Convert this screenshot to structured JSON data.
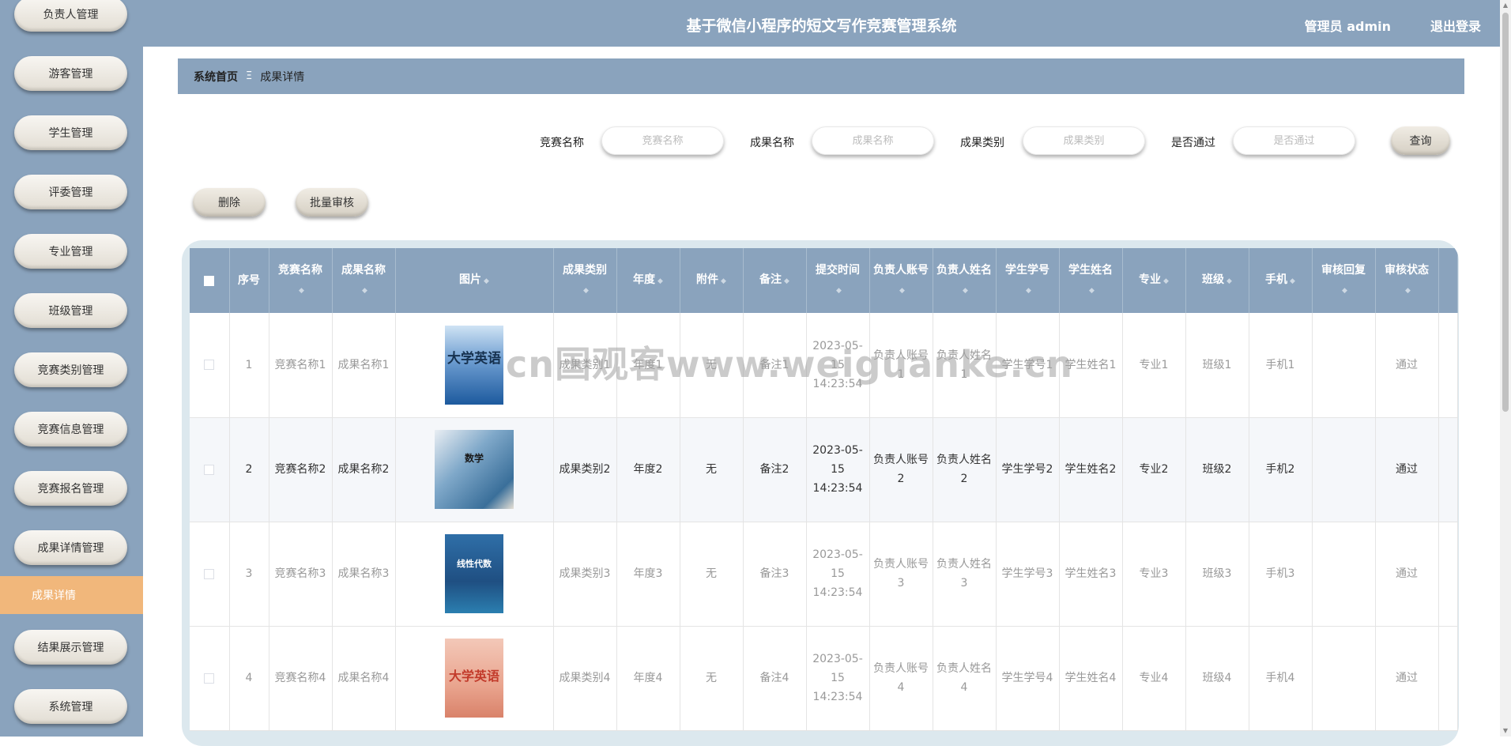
{
  "header": {
    "title": "基于微信小程序的短文写作竞赛管理系统",
    "user": "管理员 admin",
    "logout": "退出登录"
  },
  "sidebar": {
    "items": [
      "负责人管理",
      "游客管理",
      "学生管理",
      "评委管理",
      "专业管理",
      "班级管理",
      "竞赛类别管理",
      "竞赛信息管理",
      "竞赛报名管理",
      "成果详情管理",
      "结果展示管理",
      "系统管理"
    ],
    "active_sub": "成果详情"
  },
  "breadcrumb": {
    "home": "系统首页",
    "separator": "Ξ",
    "current": "成果详情"
  },
  "search": {
    "fields": [
      {
        "label": "竞赛名称",
        "placeholder": "竞赛名称"
      },
      {
        "label": "成果名称",
        "placeholder": "成果名称"
      },
      {
        "label": "成果类别",
        "placeholder": "成果类别"
      },
      {
        "label": "是否通过",
        "placeholder": "是否通过"
      }
    ],
    "query_button": "查询"
  },
  "actions": {
    "delete": "删除",
    "batch_review": "批量审核"
  },
  "table": {
    "columns": [
      "序号",
      "竞赛名称",
      "成果名称",
      "图片",
      "成果类别",
      "年度",
      "附件",
      "备注",
      "提交时间",
      "负责人账号",
      "负责人姓名",
      "学生学号",
      "学生姓名",
      "专业",
      "班级",
      "手机",
      "审核回复",
      "审核状态"
    ],
    "rows": [
      {
        "index": "1",
        "contest": "竞赛名称1",
        "name": "成果名称1",
        "image": "大学英语",
        "category": "成果类别1",
        "year": "年度1",
        "attachment": "无",
        "remark": "备注1",
        "time": "2023-05-15 14:23:54",
        "account": "负责人账号1",
        "manager": "负责人姓名1",
        "student_no": "学生学号1",
        "student": "学生姓名1",
        "major": "专业1",
        "class": "班级1",
        "phone": "手机1",
        "reply": "",
        "status": "通过"
      },
      {
        "index": "2",
        "contest": "竞赛名称2",
        "name": "成果名称2",
        "image": "数学",
        "category": "成果类别2",
        "year": "年度2",
        "attachment": "无",
        "remark": "备注2",
        "time": "2023-05-15 14:23:54",
        "account": "负责人账号2",
        "manager": "负责人姓名2",
        "student_no": "学生学号2",
        "student": "学生姓名2",
        "major": "专业2",
        "class": "班级2",
        "phone": "手机2",
        "reply": "",
        "status": "通过"
      },
      {
        "index": "3",
        "contest": "竞赛名称3",
        "name": "成果名称3",
        "image": "线性代数",
        "category": "成果类别3",
        "year": "年度3",
        "attachment": "无",
        "remark": "备注3",
        "time": "2023-05-15 14:23:54",
        "account": "负责人账号3",
        "manager": "负责人姓名3",
        "student_no": "学生学号3",
        "student": "学生姓名3",
        "major": "专业3",
        "class": "班级3",
        "phone": "手机3",
        "reply": "",
        "status": "通过"
      },
      {
        "index": "4",
        "contest": "竞赛名称4",
        "name": "成果名称4",
        "image": "大学英语",
        "category": "成果类别4",
        "year": "年度4",
        "attachment": "无",
        "remark": "备注4",
        "time": "2023-05-15 14:23:54",
        "account": "负责人账号4",
        "manager": "负责人姓名4",
        "student_no": "学生学号4",
        "student": "学生姓名4",
        "major": "专业4",
        "class": "班级4",
        "phone": "手机4",
        "reply": "",
        "status": "通过"
      }
    ]
  },
  "watermark": "cn国观客www.weiguanke.cn",
  "colors": {
    "primary": "#8aa3bd",
    "active": "#f1b77b",
    "table_frame": "#dce8ee"
  }
}
